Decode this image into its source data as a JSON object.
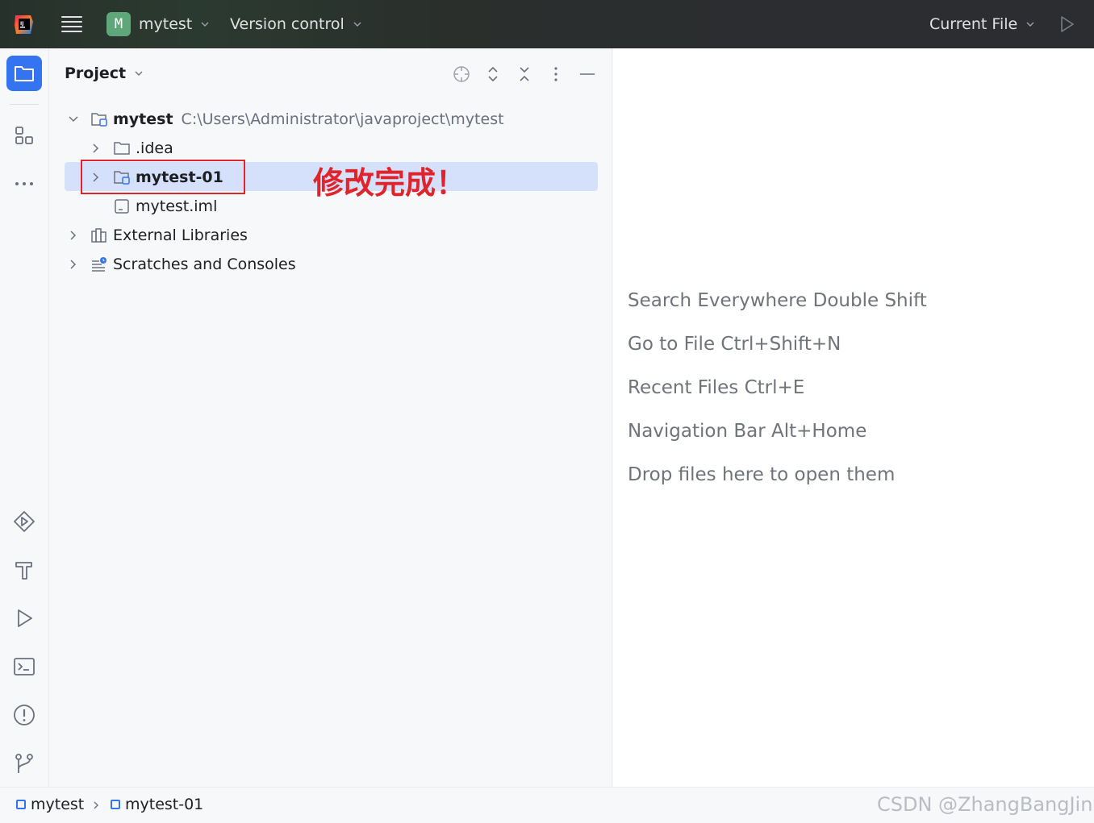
{
  "titlebar": {
    "project_badge": "M",
    "project_name": "mytest",
    "vcs_label": "Version control",
    "run_config": "Current File"
  },
  "project_panel": {
    "title": "Project"
  },
  "tree": {
    "root_name": "mytest",
    "root_path": "C:\\Users\\Administrator\\javaproject\\mytest",
    "idea": ".idea",
    "module": "mytest-01",
    "iml": "mytest.iml",
    "external_libraries": "External Libraries",
    "scratches": "Scratches and Consoles"
  },
  "annotation": "修改完成！",
  "editor_hints": [
    "Search Everywhere Double Shift",
    "Go to File Ctrl+Shift+N",
    "Recent Files Ctrl+E",
    "Navigation Bar Alt+Home",
    "Drop files here to open them"
  ],
  "statusbar": {
    "crumb_root": "mytest",
    "crumb_module": "mytest-01",
    "watermark": "CSDN @ZhangBangJin"
  },
  "colors": {
    "accent": "#3574f0",
    "selection": "#d5e1fb",
    "annotation_red": "#e0242b",
    "project_badge": "#5fa77a"
  }
}
